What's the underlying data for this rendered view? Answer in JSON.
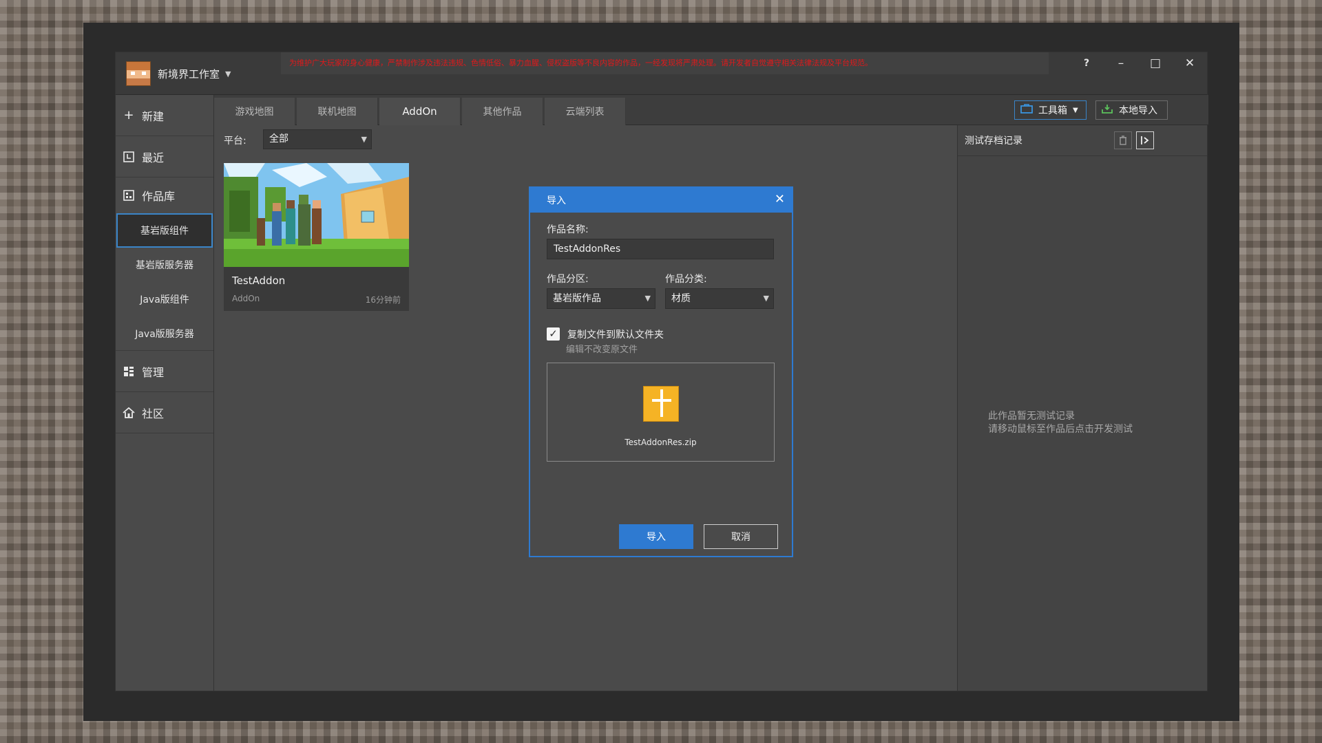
{
  "app": {
    "brand_name": "新境界工作室",
    "notice": "为维护广大玩家的身心健康，严禁制作涉及违法违规、色情低俗、暴力血腥、侵权盗版等不良内容的作品，一经发现将严肃处理。请开发者自觉遵守相关法律法规及平台规范。",
    "window_controls": {
      "help": "?",
      "minimize": "–",
      "maximize": "□",
      "close": "✕"
    }
  },
  "sidebar": {
    "new": "新建",
    "recent": "最近",
    "library": "作品库",
    "sub_items": [
      "基岩版组件",
      "基岩版服务器",
      "Java版组件",
      "Java版服务器"
    ],
    "manage": "管理",
    "community": "社区"
  },
  "tabs": [
    "游戏地图",
    "联机地图",
    "AddOn",
    "其他作品",
    "云端列表"
  ],
  "toolbar": {
    "toolbox": "工具箱",
    "local_import": "本地导入"
  },
  "filter": {
    "label": "平台:",
    "value": "全部"
  },
  "card": {
    "title": "TestAddon",
    "type": "AddOn",
    "time": "16分钟前"
  },
  "right_panel": {
    "title": "测试存档记录",
    "empty_line1": "此作品暂无测试记录",
    "empty_line2": "请移动鼠标至作品后点击开发测试"
  },
  "dialog": {
    "title": "导入",
    "name_label": "作品名称:",
    "name_value": "TestAddonRes",
    "zone_label": "作品分区:",
    "zone_value": "基岩版作品",
    "category_label": "作品分类:",
    "category_value": "材质",
    "copy_label": "复制文件到默认文件夹",
    "copy_sub": "编辑不改变原文件",
    "copy_checked": true,
    "file_name": "TestAddonRes.zip",
    "import_button": "导入",
    "cancel_button": "取消"
  },
  "colors": {
    "accent": "#2e7ad1",
    "notice_red": "#e0191b",
    "zip_icon": "#f5b325"
  }
}
